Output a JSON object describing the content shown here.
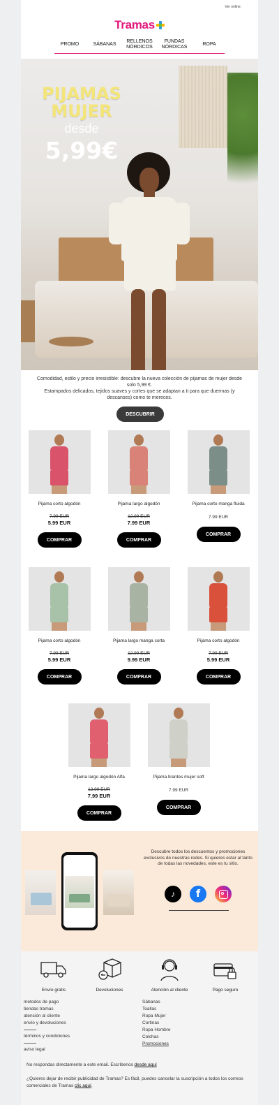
{
  "header": {
    "ver_online": "Ver online.",
    "logo_text": "Tramas",
    "nav": [
      {
        "label": "PROMO"
      },
      {
        "label": "SÁBANAS"
      },
      {
        "label": "RELLENOS NÓRDICOS"
      },
      {
        "label": "FUNDAS NÓRDICAS"
      },
      {
        "label": "ROPA"
      }
    ]
  },
  "hero": {
    "title_line1": "PIJAMAS",
    "title_line2": "MUJER",
    "desde": "desde",
    "price": "5,99€"
  },
  "intro": {
    "text1": "Comodidad, estilo y precio irresistible: descubre la nueva colección de pijamas de mujer desde solo 5,99 €.",
    "text2": "Estampados delicados, tejidos suaves y cortes que se adaptan a ti para que duermas (y descanses) como te mereces.",
    "button": "DESCUBRIR"
  },
  "products": [
    {
      "name": "Pijama corto algodón",
      "old_price": "7.99 EUR",
      "price": "5.99 EUR",
      "button": "COMPRAR",
      "color": "#d9536b"
    },
    {
      "name": "Pijama largo algodón",
      "old_price": "12.99 EUR",
      "price": "7.99 EUR",
      "button": "COMPRAR",
      "color": "#d98277"
    },
    {
      "name": "Pijama corto manga fluida",
      "old_price": "",
      "price": "7.99 EUR",
      "button": "COMPRAR",
      "color": "#7b8f88"
    },
    {
      "name": "Pijama corto algodón",
      "old_price": "7.99 EUR",
      "price": "5.99 EUR",
      "button": "COMPRAR",
      "color": "#a7c2a8"
    },
    {
      "name": "Pijama largo manga corta",
      "old_price": "12.99 EUR",
      "price": "9.99 EUR",
      "button": "COMPRAR",
      "color": "#a9b3a3"
    },
    {
      "name": "Pijama corto algodón",
      "old_price": "7.99 EUR",
      "price": "5.99 EUR",
      "button": "COMPRAR",
      "color": "#d9503b"
    },
    {
      "name": "Pijama largo algodón Alfa",
      "old_price": "12.99 EUR",
      "price": "7.99 EUR",
      "button": "COMPRAR",
      "color": "#e06070"
    },
    {
      "name": "Pijama tirantes mujer soft",
      "old_price": "",
      "price": "7.99 EUR",
      "button": "COMPRAR",
      "color": "#cfd0c8"
    }
  ],
  "social": {
    "text": "Descubre todos los descuentos y promociones exclusivos de nuestras redes. Si quieres estar al tanto de todas las novedades, este es tu sitio.",
    "icons": [
      "tiktok-icon",
      "facebook-icon",
      "instagram-icon"
    ]
  },
  "services": [
    {
      "label": "Envío gratis",
      "icon": "truck-icon"
    },
    {
      "label": "Devoluciones",
      "icon": "box-return-icon"
    },
    {
      "label": "Atención al cliente",
      "icon": "headset-icon"
    },
    {
      "label": "Pago seguro",
      "icon": "card-lock-icon"
    }
  ],
  "links_left": [
    "metodos de pago",
    "tiendas tramas",
    "atención al cliente",
    "envío y devoluciones"
  ],
  "links_left2": [
    "términos y condiciones"
  ],
  "links_left3": [
    "aviso legal"
  ],
  "links_right": [
    "Sábanas",
    "Toallas",
    "Ropa Mujer",
    "Cortinas",
    "Ropa Hombre",
    "Colchas",
    "Promociones"
  ],
  "footer": {
    "no_reply": "No respondas directamente a este email. Escríbenos",
    "no_reply_link": "desde aquí",
    "unsubscribe": "¿Quieres dejar de recibir publicidad de Tramas? Es fácil, puedes cancelar la suscripción a todos los correos comerciales de Tramas",
    "unsubscribe_link": "clic aquí",
    "period": "."
  },
  "colors": {
    "brand_pink": "#e3187b",
    "hero_title": "#f3e579",
    "social_bg": "#fbe9d9"
  }
}
